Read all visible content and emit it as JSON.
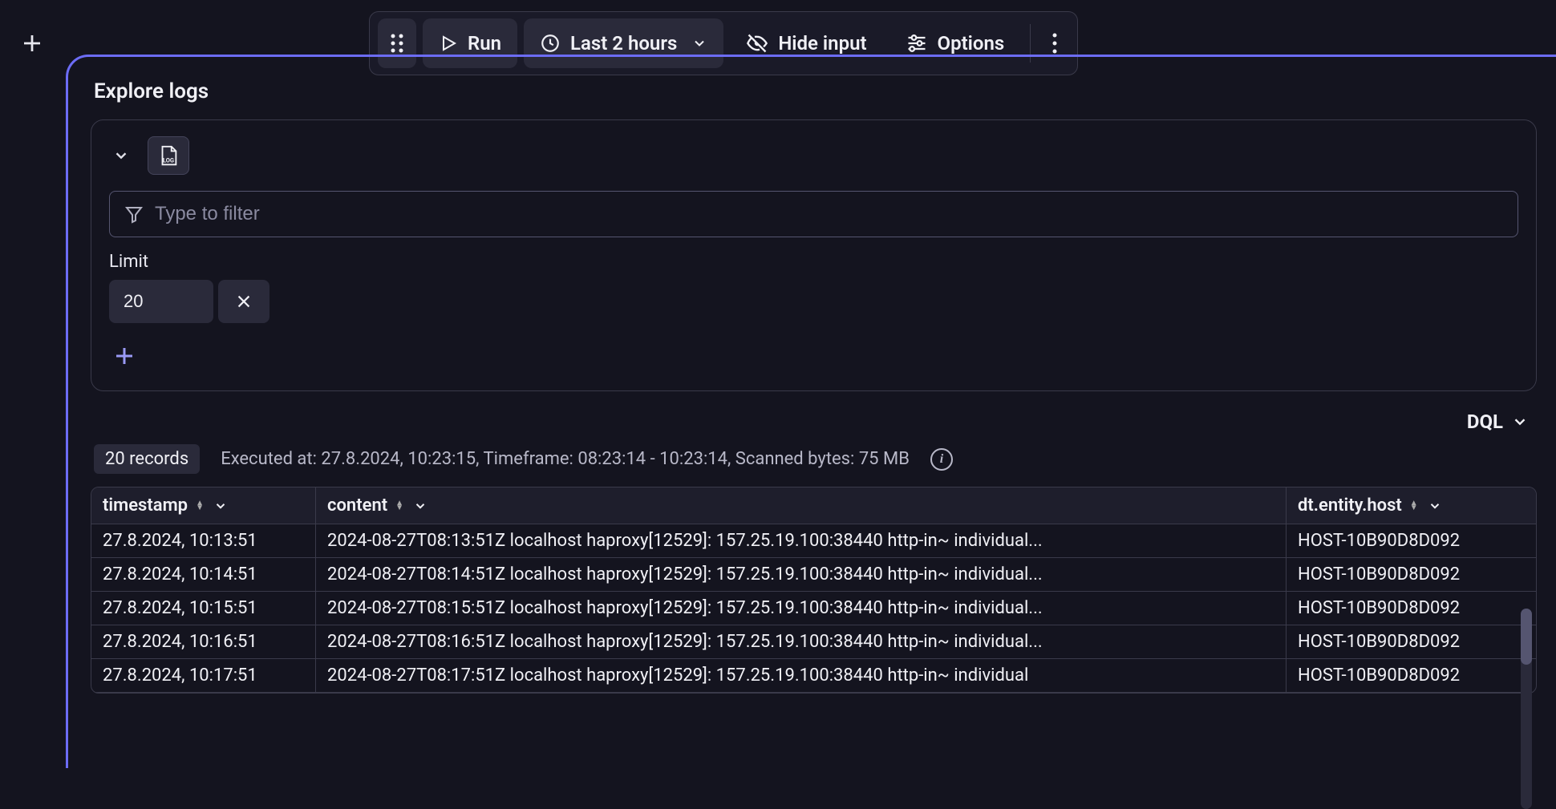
{
  "toolbar": {
    "run": "Run",
    "timeframe": "Last 2 hours",
    "hide_input": "Hide input",
    "options": "Options"
  },
  "panel": {
    "title": "Explore logs"
  },
  "filter": {
    "placeholder": "Type to filter",
    "limit_label": "Limit",
    "limit_value": "20"
  },
  "dql": {
    "label": "DQL"
  },
  "results": {
    "records": "20 records",
    "exec_info": "Executed at: 27.8.2024, 10:23:15, Timeframe: 08:23:14 - 10:23:14, Scanned bytes: 75 MB"
  },
  "table": {
    "columns": {
      "timestamp": "timestamp",
      "content": "content",
      "host": "dt.entity.host"
    },
    "rows": [
      {
        "ts": "27.8.2024, 10:13:51",
        "content": "2024-08-27T08:13:51Z localhost haproxy[12529]: 157.25.19.100:38440 http-in~ individual...",
        "host": "HOST-10B90D8D092"
      },
      {
        "ts": "27.8.2024, 10:14:51",
        "content": "2024-08-27T08:14:51Z localhost haproxy[12529]: 157.25.19.100:38440 http-in~ individual...",
        "host": "HOST-10B90D8D092"
      },
      {
        "ts": "27.8.2024, 10:15:51",
        "content": "2024-08-27T08:15:51Z localhost haproxy[12529]: 157.25.19.100:38440 http-in~ individual...",
        "host": "HOST-10B90D8D092"
      },
      {
        "ts": "27.8.2024, 10:16:51",
        "content": "2024-08-27T08:16:51Z localhost haproxy[12529]: 157.25.19.100:38440 http-in~ individual...",
        "host": "HOST-10B90D8D092"
      },
      {
        "ts": "27.8.2024, 10:17:51",
        "content": "2024-08-27T08:17:51Z localhost haproxy[12529]: 157.25.19.100:38440 http-in~ individual",
        "host": "HOST-10B90D8D092"
      }
    ]
  }
}
